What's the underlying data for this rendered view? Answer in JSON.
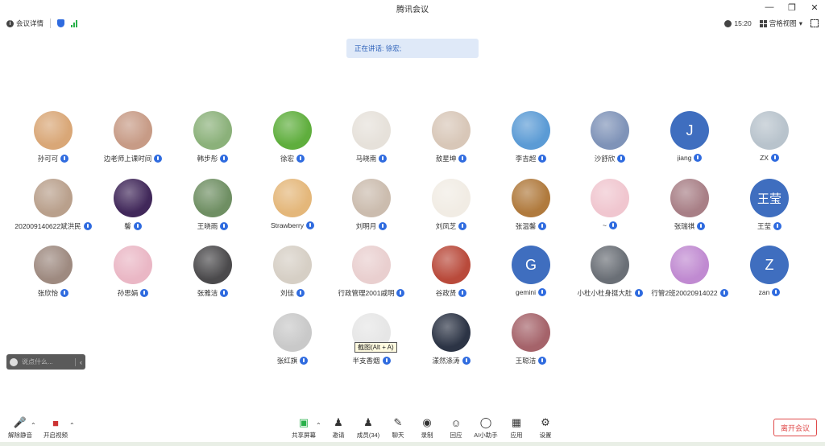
{
  "window": {
    "title": "腾讯会议"
  },
  "infobar": {
    "meeting_details": "会议详情",
    "time": "15:20",
    "view": "宫格视图"
  },
  "speaking": "正在讲话: 徐宏;",
  "tooltip": "截图(Alt + A)",
  "chat": {
    "placeholder": "说点什么..."
  },
  "participants": [
    {
      "name": "孙可可",
      "color": "#d9a777"
    },
    {
      "name": "边老师上课时间",
      "color": "#c79b86"
    },
    {
      "name": "韩步彤",
      "color": "#8bb17a"
    },
    {
      "name": "徐宏",
      "color": "#5fae3d"
    },
    {
      "name": "马晓南",
      "color": "#e6e1da"
    },
    {
      "name": "敖星坤",
      "color": "#d8c7b8"
    },
    {
      "name": "李吉超",
      "color": "#5b9bd5"
    },
    {
      "name": "沙舒欣",
      "color": "#7f93b8"
    },
    {
      "name": "jiang",
      "avatar_text": "J",
      "letter": true
    },
    {
      "name": "ZX",
      "color": "#b8c3cc"
    },
    {
      "name": "202009140622斌洪民",
      "color": "#b9a08c"
    },
    {
      "name": "馨",
      "color": "#41285a"
    },
    {
      "name": "王晓雨",
      "color": "#6f8f63"
    },
    {
      "name": "Strawberry",
      "color": "#e4b77a"
    },
    {
      "name": "刘明月",
      "color": "#cbbcae"
    },
    {
      "name": "刘凤芝",
      "color": "#f1ece4"
    },
    {
      "name": "张温馨",
      "color": "#b07a3d"
    },
    {
      "name": "~",
      "color": "#f0c6cf"
    },
    {
      "name": "张瑞祺",
      "color": "#a87f86"
    },
    {
      "name": "王莹",
      "avatar_text": "王莹",
      "text": true
    },
    {
      "name": "张欣怡",
      "color": "#9e8a80"
    },
    {
      "name": "孙思娟",
      "color": "#eab7c5"
    },
    {
      "name": "张雅洁",
      "color": "#4b4a4c"
    },
    {
      "name": "刘佳",
      "color": "#d6cfc5"
    },
    {
      "name": "行政管理2001戚明",
      "color": "#e9cfcf"
    },
    {
      "name": "谷政贤",
      "color": "#b94a3b"
    },
    {
      "name": "gemini",
      "avatar_text": "G",
      "letter": true
    },
    {
      "name": "小杜小杜身挺大肚",
      "color": "#6a6f76"
    },
    {
      "name": "行管2班20020914022",
      "color": "#c08ad1"
    },
    {
      "name": "zan",
      "avatar_text": "Z",
      "letter": true
    },
    {
      "name": "张红旗",
      "color": "#c9c9c9"
    },
    {
      "name": "半支香烟",
      "color": "#e6e6e6"
    },
    {
      "name": "漾然涤涛",
      "color": "#2c3445"
    },
    {
      "name": "王聪洁",
      "color": "#a5636a"
    }
  ],
  "toolbar": {
    "unmute": "解除静音",
    "video": "开启视频",
    "share": "共享屏幕",
    "invite": "邀请",
    "members": "成员(34)",
    "chat": "聊天",
    "record": "录制",
    "react": "回应",
    "ai": "AI小助手",
    "apps": "应用",
    "settings": "设置",
    "leave": "离开会议"
  }
}
